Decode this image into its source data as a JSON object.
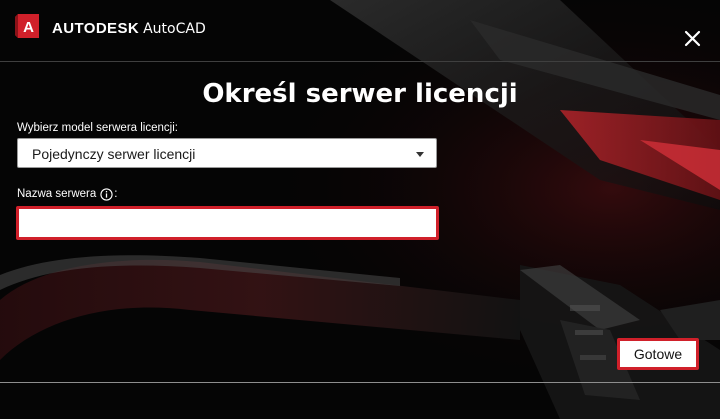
{
  "app": {
    "company": "AUTODESK",
    "product": "AutoCAD",
    "accent_color": "#d0202a",
    "logo_letter": "A"
  },
  "dialog": {
    "title": "Określ serwer licencji",
    "model_label": "Wybierz model serwera licencji:",
    "model_selected": "Pojedynczy serwer licencji",
    "server_label_prefix": "Nazwa serwera",
    "server_label_suffix": ":",
    "server_value": "",
    "done_label": "Gotowe"
  },
  "icons": {
    "close": "close-icon",
    "info": "info-icon",
    "dropdown": "chevron-down-icon"
  }
}
